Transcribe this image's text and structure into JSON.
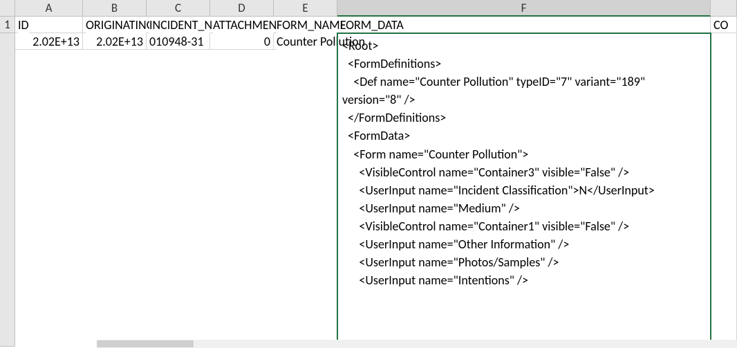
{
  "columns": {
    "A": "A",
    "B": "B",
    "C": "C",
    "D": "D",
    "E": "E",
    "F": "F"
  },
  "rowNumbers": {
    "r1": "1"
  },
  "headers": {
    "A": "ID",
    "B": "ORIGINATING_ID",
    "C": "INCIDENT_NUMBER",
    "D": "ATTACHMENT_ID",
    "E": "FORM_NAME",
    "F": "FORM_DATA",
    "G": "CO"
  },
  "row2": {
    "A": "2.02E+13",
    "B": "2.02E+13",
    "C": "010948-31",
    "D": "0",
    "E": "Counter Pollution",
    "F": "<Root>\n  <FormDefinitions>\n    <Def name=\"Counter Pollution\" typeID=\"7\" variant=\"189\" version=\"8\" />\n  </FormDefinitions>\n  <FormData>\n    <Form name=\"Counter Pollution\">\n      <VisibleControl name=\"Container3\" visible=\"False\" />\n      <UserInput name=\"Incident Classification\">N</UserInput>\n      <UserInput name=\"Medium\" />\n      <VisibleControl name=\"Container1\" visible=\"False\" />\n      <UserInput name=\"Other Information\" />\n      <UserInput name=\"Photos/Samples\" />\n      <UserInput name=\"Intentions\" />"
  }
}
